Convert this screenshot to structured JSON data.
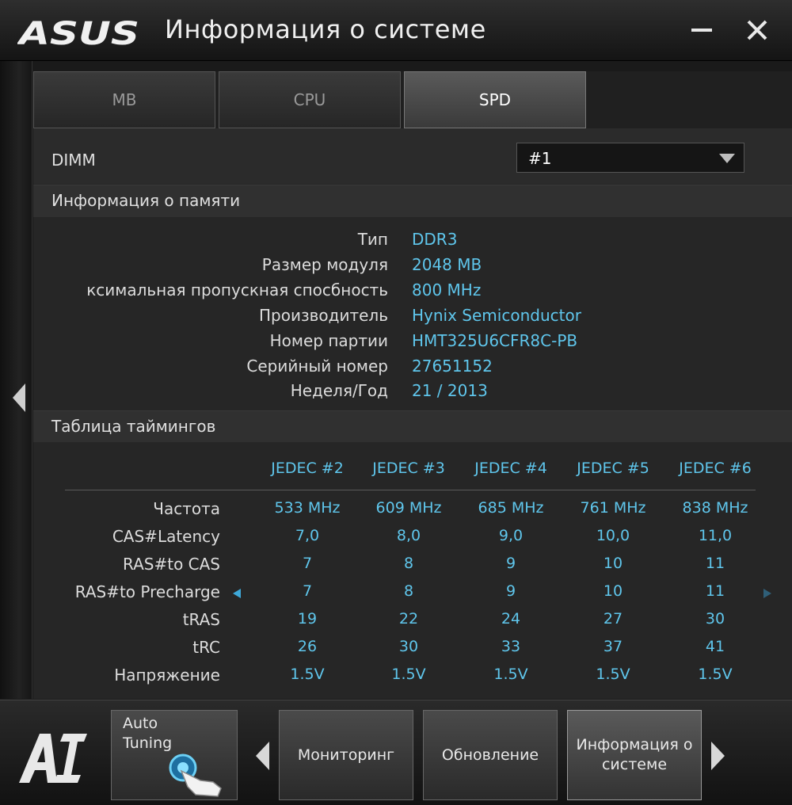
{
  "window": {
    "brand": "ASUS",
    "title": "Информация о системе"
  },
  "tabs": [
    {
      "label": "MB",
      "active": false
    },
    {
      "label": "CPU",
      "active": false
    },
    {
      "label": "SPD",
      "active": true
    }
  ],
  "dimm": {
    "label": "DIMM",
    "selected": "#1"
  },
  "memory_info": {
    "header": "Информация о памяти",
    "rows": [
      {
        "label": "Тип",
        "value": "DDR3"
      },
      {
        "label": "Размер модуля",
        "value": "2048 MB"
      },
      {
        "label": "ксимальная пропускная спосбность",
        "value": "800 MHz"
      },
      {
        "label": "Производитель",
        "value": "Hynix Semiconductor"
      },
      {
        "label": "Номер партии",
        "value": "HMT325U6CFR8C-PB"
      },
      {
        "label": "Серийный номер",
        "value": "27651152"
      },
      {
        "label": "Неделя/Год",
        "value": "21 / 2013"
      }
    ]
  },
  "timing_table": {
    "header": "Таблица таймингов",
    "columns": [
      "JEDEC #2",
      "JEDEC #3",
      "JEDEC #4",
      "JEDEC #5",
      "JEDEC #6"
    ],
    "rows": [
      {
        "label": "Частота",
        "values": [
          "533 MHz",
          "609 MHz",
          "685 MHz",
          "761 MHz",
          "838 MHz"
        ]
      },
      {
        "label": "CAS#Latency",
        "values": [
          "7,0",
          "8,0",
          "9,0",
          "10,0",
          "11,0"
        ]
      },
      {
        "label": "RAS#to CAS",
        "values": [
          "7",
          "8",
          "9",
          "10",
          "11"
        ]
      },
      {
        "label": "RAS#to Precharge",
        "values": [
          "7",
          "8",
          "9",
          "10",
          "11"
        ]
      },
      {
        "label": "tRAS",
        "values": [
          "19",
          "22",
          "24",
          "27",
          "30"
        ]
      },
      {
        "label": "tRC",
        "values": [
          "26",
          "30",
          "33",
          "37",
          "41"
        ]
      },
      {
        "label": "Напряжение",
        "values": [
          "1.5V",
          "1.5V",
          "1.5V",
          "1.5V",
          "1.5V"
        ]
      }
    ]
  },
  "bottom": {
    "auto_tuning": "Auto\nTuning",
    "buttons": [
      {
        "label": "Мониторинг",
        "active": false
      },
      {
        "label": "Обновление",
        "active": false
      },
      {
        "label": "Информация о системе",
        "active": true
      }
    ]
  },
  "colors": {
    "accent": "#5fc6ec",
    "background": "#262626"
  }
}
